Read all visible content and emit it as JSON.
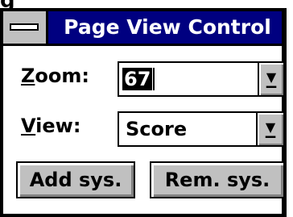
{
  "window": {
    "title": "Page View Control"
  },
  "zoom": {
    "label_accel": "Z",
    "label_rest": "oom:",
    "value": "67"
  },
  "view": {
    "label_accel": "V",
    "label_rest": "iew:",
    "value": "Score"
  },
  "buttons": {
    "add": "Add sys.",
    "remove": "Rem. sys."
  },
  "icons": {
    "system_menu": "system-menu-icon",
    "dropdown": "dropdown-arrow-icon"
  },
  "colors": {
    "titlebar": "#000080",
    "face": "#c0c0c0"
  }
}
